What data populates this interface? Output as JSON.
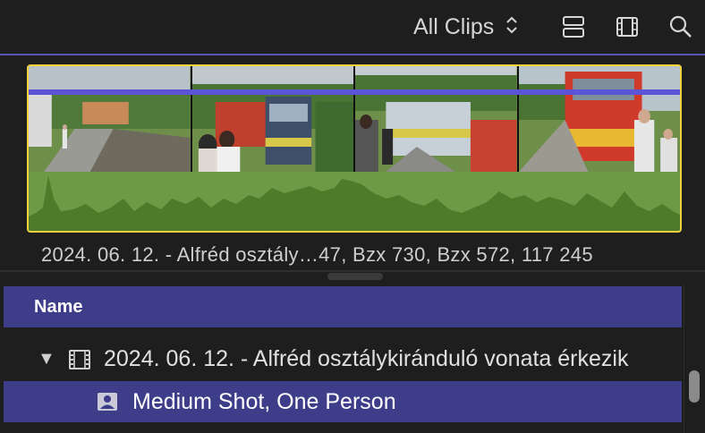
{
  "toolbar": {
    "clips_filter_label": "All Clips",
    "icons": [
      "chevron-updown-icon",
      "clip-appearance-icon",
      "filmstrip-icon",
      "search-icon"
    ]
  },
  "filmstrip": {
    "caption": "2024. 06. 12. - Alfréd osztály…47, Bzx 730, Bzx 572, 117 245",
    "selection_color": "#f2d23c",
    "keyword_range_color": "#5c54d6",
    "audio_color": "#5f7f33"
  },
  "browser_list": {
    "header_name": "Name",
    "event_row_label": "2024. 06. 12. - Alfréd osztálykiránduló vonata érkezik",
    "keyword_row_label": "Medium Shot, One Person",
    "selection_color": "#3d3d8a"
  }
}
